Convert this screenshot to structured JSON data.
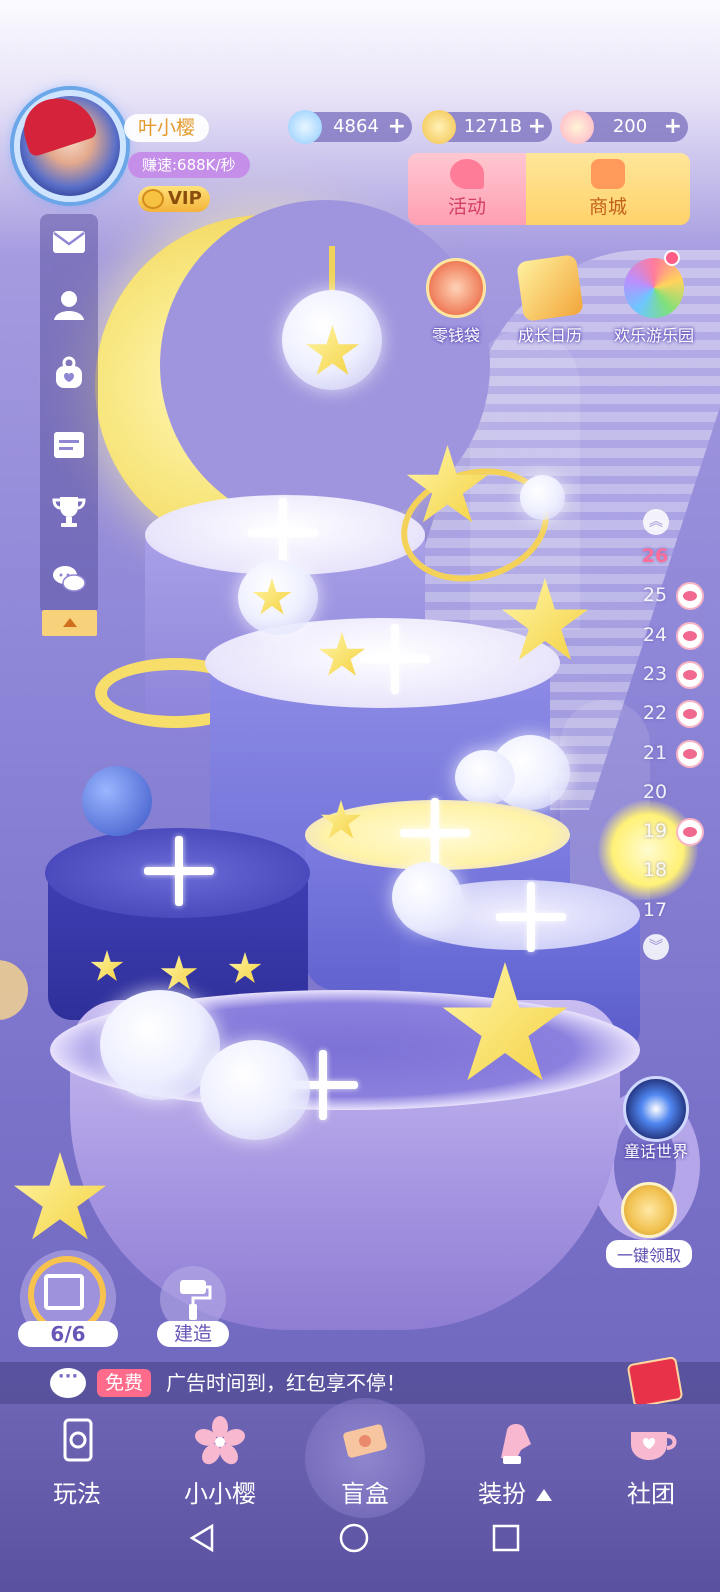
{
  "player": {
    "name": "叶小樱",
    "speed": "赚速:688K/秒",
    "vip": "VIP"
  },
  "currencies": [
    {
      "value": "4864",
      "icon": "snowflake-gem-icon",
      "color": "#8ecbff"
    },
    {
      "value": "1271B",
      "icon": "gold-coin-icon",
      "color": "#f3c14a"
    },
    {
      "value": "200",
      "icon": "rainbow-star-icon",
      "color": "#ffb0c8"
    }
  ],
  "top_tabs": {
    "activity": "活动",
    "shop": "商城"
  },
  "features": [
    {
      "label": "零钱袋",
      "icon": "coin-purse-icon"
    },
    {
      "label": "成长日历",
      "icon": "growth-calendar-icon"
    },
    {
      "label": "欢乐游乐园",
      "icon": "ferris-wheel-icon"
    }
  ],
  "sidebar": {
    "items": [
      {
        "icon": "mail-icon"
      },
      {
        "icon": "friends-icon"
      },
      {
        "icon": "pet-bag-icon"
      },
      {
        "icon": "notice-board-icon"
      },
      {
        "icon": "trophy-icon"
      },
      {
        "icon": "chat-icon"
      }
    ],
    "toggle_icon": "collapse-up-icon"
  },
  "floors": {
    "current": "26",
    "list": [
      {
        "num": "26",
        "badge": false
      },
      {
        "num": "25",
        "badge": true
      },
      {
        "num": "24",
        "badge": true
      },
      {
        "num": "23",
        "badge": true
      },
      {
        "num": "22",
        "badge": true
      },
      {
        "num": "21",
        "badge": true
      },
      {
        "num": "20",
        "badge": false
      },
      {
        "num": "19",
        "badge": true
      },
      {
        "num": "18",
        "badge": false
      },
      {
        "num": "17",
        "badge": false
      }
    ]
  },
  "right_actions": {
    "fairy_world": "童话世界",
    "collect_all": "一键领取"
  },
  "bottom_controls": {
    "gift_count": "6/6",
    "build": "建造"
  },
  "ad_bar": {
    "free_tag": "免费",
    "text": "广告时间到，红包享不停！"
  },
  "nav": {
    "items": [
      {
        "label": "玩法",
        "icon": "phone-card-icon"
      },
      {
        "label": "小小樱",
        "icon": "sakura-flower-icon"
      },
      {
        "label": "盲盒",
        "icon": "blind-box-ticket-icon"
      },
      {
        "label": "装扮",
        "icon": "outfit-glove-icon"
      },
      {
        "label": "社团",
        "icon": "heart-teacup-icon"
      }
    ]
  },
  "colors": {
    "accent_pink": "#ff6b8a",
    "gold": "#f7c34e",
    "purple_bg": "#8f87d8"
  }
}
